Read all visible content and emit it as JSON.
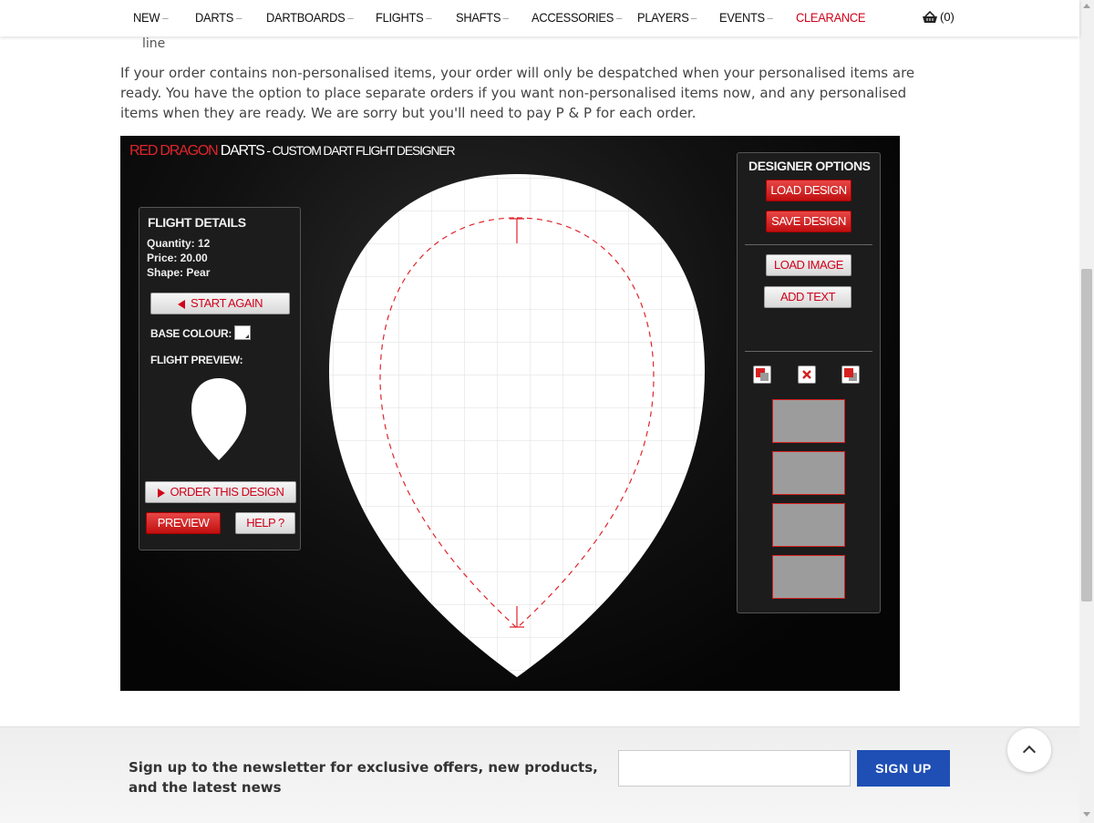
{
  "nav": {
    "items": [
      {
        "label": "NEW",
        "dropdown": true
      },
      {
        "label": "DARTS",
        "dropdown": true
      },
      {
        "label": "DARTBOARDS",
        "dropdown": true
      },
      {
        "label": "FLIGHTS",
        "dropdown": true
      },
      {
        "label": "SHAFTS",
        "dropdown": true
      },
      {
        "label": "ACCESSORIES",
        "dropdown": true
      },
      {
        "label": "PLAYERS",
        "dropdown": true
      },
      {
        "label": "EVENTS",
        "dropdown": true
      },
      {
        "label": "CLEARANCE",
        "dropdown": false
      }
    ],
    "cart_count": "(0)",
    "cart_icon": "basket-icon",
    "clearance_color": "#d0021b"
  },
  "content": {
    "fragment": "line",
    "notice": "If your order contains non-personalised items, your order will only be despatched when your personalised items are ready. You have the option to place separate orders if you want non-personalised items now, and any personalised items when they are ready. We are sorry but you'll need to pay P & P for each order."
  },
  "designer": {
    "title_brand": "RED DRAGON",
    "title_main": " DARTS",
    "title_sub": " - CUSTOM DART FLIGHT DESIGNER",
    "flight_details": {
      "heading": "FLIGHT DETAILS",
      "quantity": "Quantity: 12",
      "price": "Price: 20.00",
      "shape": "Shape: Pear",
      "start_again": "START AGAIN",
      "base_colour_label": "BASE COLOUR:",
      "flight_preview_label": "FLIGHT PREVIEW:",
      "order_button": "ORDER THIS DESIGN",
      "preview_button": "PREVIEW",
      "help_button": "HELP ?"
    },
    "options": {
      "heading": "DESIGNER OPTIONS",
      "load_design": "LOAD DESIGN",
      "save_design": "SAVE DESIGN",
      "load_image": "LOAD IMAGE",
      "add_text": "ADD TEXT",
      "layer_slots": 4
    },
    "accent_color": "#e0242b"
  },
  "footer": {
    "newsletter_text": "Sign up to the newsletter for exclusive offers, new products, and the latest news",
    "email_value": "",
    "signup_label": "SIGN UP",
    "signup_color": "#1f4fb5"
  }
}
